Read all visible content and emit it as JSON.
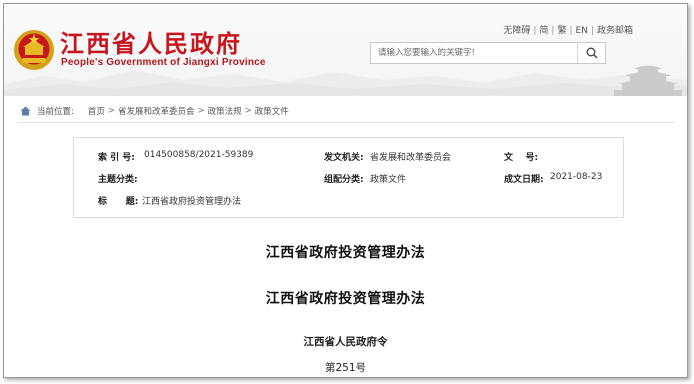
{
  "header": {
    "site_title": "江西省人民政府",
    "site_subtitle": "People's Government of Jiangxi Province",
    "top_links": [
      "无障碍",
      "简",
      "繁",
      "EN",
      "政务邮箱"
    ],
    "search": {
      "placeholder": "请输入您要输入的关键字!"
    }
  },
  "breadcrumb": {
    "label": "当前位置:",
    "items": [
      "首页",
      "省发展和改革委员会",
      "政策法规",
      "政策文件"
    ],
    "separator": ">"
  },
  "info": {
    "index_label": "索 引 号:",
    "index_value": "014500858/2021-59389",
    "issuer_label": "发文机关:",
    "issuer_value": "省发展和改革委员会",
    "docno_label": "文    号:",
    "docno_value": "",
    "topic_label": "主题分类:",
    "topic_value": "",
    "category_label": "组配分类:",
    "category_value": "政策文件",
    "date_label": "成文日期:",
    "date_value": "2021-08-23",
    "title_label": "标      题:",
    "title_value": "江西省政府投资管理办法"
  },
  "article": {
    "heading": "江西省政府投资管理办法",
    "subheading": "江西省政府投资管理办法",
    "issuer": "江西省人民政府令",
    "number": "第251号"
  },
  "colors": {
    "brand_red": "#c8161d",
    "border": "#dcdcdc"
  }
}
